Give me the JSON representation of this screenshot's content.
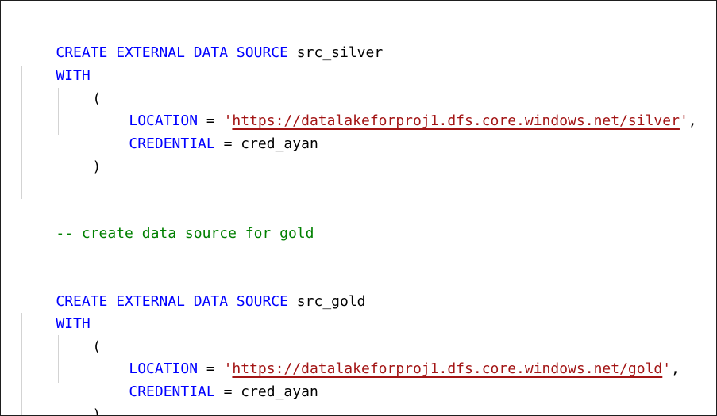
{
  "editor": {
    "block1": {
      "create": "CREATE EXTERNAL DATA SOURCE",
      "name": " src_silver",
      "with": "WITH",
      "open_paren": "(",
      "location_kw": "LOCATION",
      "equals": " = ",
      "quote_open": "'",
      "url": "https://datalakeforproj1.dfs.core.windows.net/silver",
      "quote_close": "'",
      "comma": ",",
      "credential_kw": "CREDENTIAL",
      "credential_value": " = cred_ayan",
      "close_paren": ")"
    },
    "comment": "-- create data source for gold",
    "block2": {
      "create": "CREATE EXTERNAL DATA SOURCE",
      "name": " src_gold",
      "with": "WITH",
      "open_paren": "(",
      "location_kw": "LOCATION",
      "equals": " = ",
      "quote_open": "'",
      "url": "https://datalakeforproj1.dfs.core.windows.net/gold",
      "quote_close": "'",
      "comma": ",",
      "credential_kw": "CREDENTIAL",
      "credential_value": " = cred_ayan",
      "close_paren": ")"
    }
  }
}
